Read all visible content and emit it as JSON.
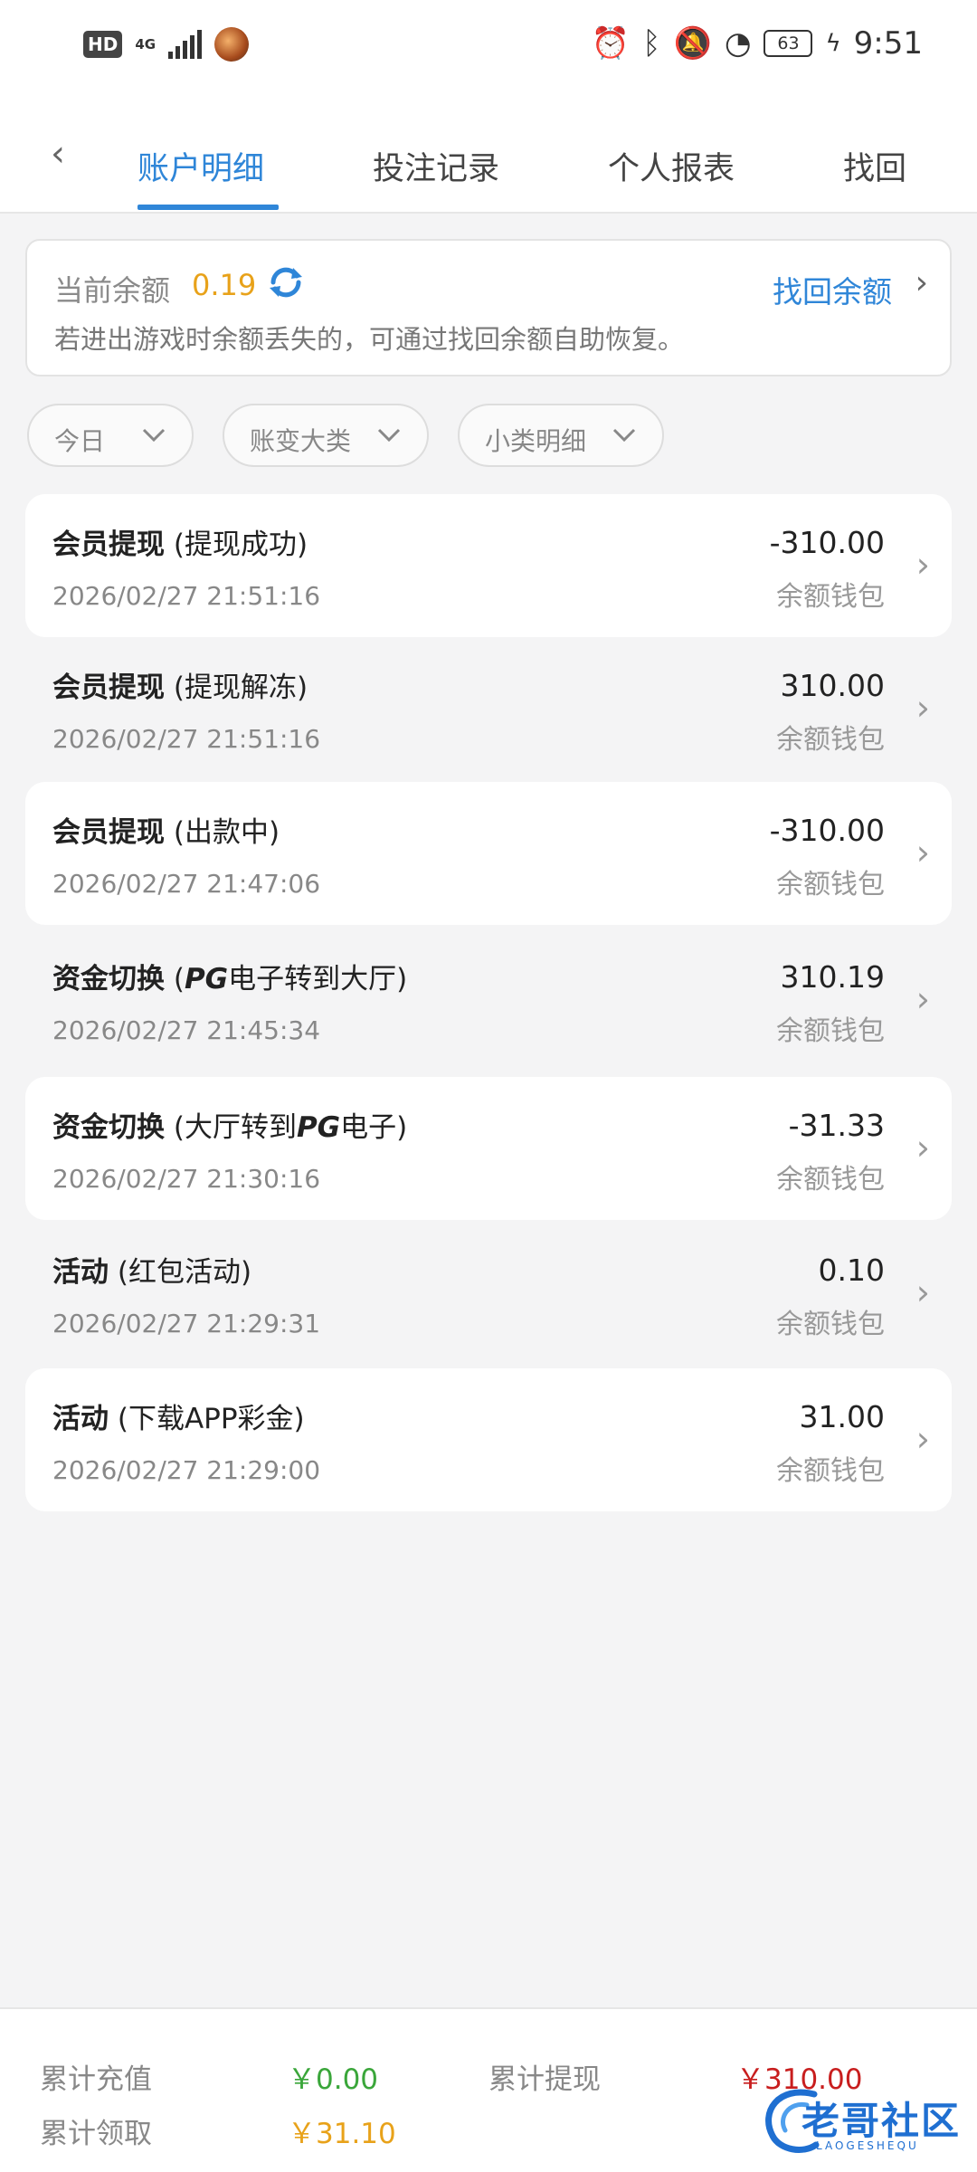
{
  "status": {
    "hd": "HD",
    "network": "4G",
    "battery": "63",
    "time": "9:51"
  },
  "tabs": [
    {
      "label": "账户明细",
      "active": true
    },
    {
      "label": "投注记录",
      "active": false
    },
    {
      "label": "个人报表",
      "active": false
    },
    {
      "label": "找回",
      "active": false
    }
  ],
  "balance": {
    "label": "当前余额",
    "value": "0.19",
    "recover_label": "找回余额",
    "tip": "若进出游戏时余额丢失的，可通过找回余额自助恢复。"
  },
  "filters": [
    {
      "label": "今日"
    },
    {
      "label": "账变大类"
    },
    {
      "label": "小类明细"
    }
  ],
  "records": [
    {
      "category": "会员提现",
      "detail_pre": " (提现成功)",
      "pg": "",
      "detail_post": "",
      "time": "2026/02/27 21:51:16",
      "amount": "-310.00",
      "wallet": "余额钱包"
    },
    {
      "category": "会员提现",
      "detail_pre": " (提现解冻)",
      "pg": "",
      "detail_post": "",
      "time": "2026/02/27 21:51:16",
      "amount": "310.00",
      "wallet": "余额钱包"
    },
    {
      "category": "会员提现",
      "detail_pre": " (出款中)",
      "pg": "",
      "detail_post": "",
      "time": "2026/02/27 21:47:06",
      "amount": "-310.00",
      "wallet": "余额钱包"
    },
    {
      "category": "资金切换",
      "detail_pre": " (",
      "pg": "PG",
      "detail_post": "电子转到大厅)",
      "time": "2026/02/27 21:45:34",
      "amount": "310.19",
      "wallet": "余额钱包"
    },
    {
      "category": "资金切换",
      "detail_pre": " (大厅转到",
      "pg": "PG",
      "detail_post": "电子)",
      "time": "2026/02/27 21:30:16",
      "amount": "-31.33",
      "wallet": "余额钱包"
    },
    {
      "category": "活动",
      "detail_pre": " (红包活动)",
      "pg": "",
      "detail_post": "",
      "time": "2026/02/27 21:29:31",
      "amount": "0.10",
      "wallet": "余额钱包"
    },
    {
      "category": "活动",
      "detail_pre": " (下载APP彩金)",
      "pg": "",
      "detail_post": "",
      "time": "2026/02/27 21:29:00",
      "amount": "31.00",
      "wallet": "余额钱包"
    }
  ],
  "summary": {
    "recharge_label": "累计充值",
    "recharge_value": "￥0.00",
    "withdraw_label": "累计提现",
    "withdraw_value": "￥310.00",
    "claim_label": "累计领取",
    "claim_value": "￥31.10"
  },
  "watermark": {
    "text": "老哥社区",
    "sub": "LAOGESHEQU"
  },
  "colors": {
    "accent": "#2f86d8",
    "balance": "#e8a21a",
    "recharge": "#3aa63a",
    "withdraw": "#c81e1e",
    "claim": "#e8a21a"
  }
}
